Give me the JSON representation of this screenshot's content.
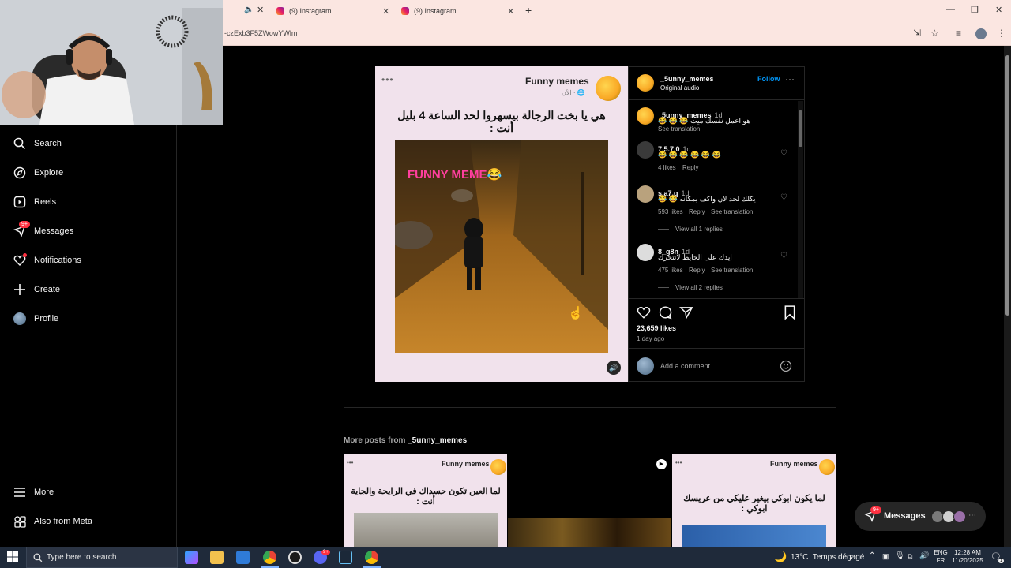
{
  "browser": {
    "tabs": [
      {
        "label": "(9) Instagram"
      },
      {
        "label": "(9) Instagram"
      }
    ],
    "url": "-czExb3F5ZWowYWlm"
  },
  "sidebar": {
    "items": [
      {
        "label": "Search",
        "icon": "search-icon"
      },
      {
        "label": "Explore",
        "icon": "compass-icon"
      },
      {
        "label": "Reels",
        "icon": "reels-icon"
      },
      {
        "label": "Messages",
        "icon": "messenger-icon",
        "badge": "9+"
      },
      {
        "label": "Notifications",
        "icon": "heart-icon"
      },
      {
        "label": "Create",
        "icon": "plus-icon"
      },
      {
        "label": "Profile",
        "icon": "avatar"
      }
    ],
    "more": "More",
    "also_from_meta": "Also from Meta"
  },
  "post": {
    "media": {
      "page_name": "Funny memes",
      "time_line": "الآن · 🌐",
      "caption": "هي يا بخت الرجالة بيسهروا لحد الساعة 4 بليل أنت :",
      "overlay_logo": "FUNNY MEME😂"
    },
    "author": "_5unny_memes",
    "follow_label": "Follow",
    "audio": "Original audio",
    "comments": [
      {
        "user": "_5unny_memes",
        "time": "1d",
        "text": "هو اعمل نفسك ميت 😂 😂 😂",
        "translation": "See translation"
      },
      {
        "user": "7.5.7.0",
        "time": "1d",
        "text": "😂 😂 😂 😂 😂 😂",
        "likes": "4 likes",
        "reply": "Reply"
      },
      {
        "user": "s.a7.q",
        "time": "1d",
        "text": "يكلك لحد لان واكف بمكانه 😂 😂",
        "likes": "593 likes",
        "reply": "Reply",
        "translation": "See translation",
        "view_replies": "View all 1 replies"
      },
      {
        "user": "8_g8n",
        "time": "1d",
        "text": "ايدك على الحايط لاتتحرك",
        "likes": "475 likes",
        "reply": "Reply",
        "translation": "See translation",
        "view_replies": "View all 2 replies"
      }
    ],
    "likes": "23,659 likes",
    "posted": "1 day ago",
    "comment_placeholder": "Add a comment..."
  },
  "more_posts": {
    "heading_prefix": "More posts from ",
    "heading_user": "_5unny_memes",
    "thumbs": [
      {
        "page_name": "Funny memes",
        "caption": "لما العين تكون حسداك في الرايحة والجاية أنت :"
      },
      {
        "page_name": "",
        "caption": ""
      },
      {
        "page_name": "Funny memes",
        "caption": "لما يكون ابوكي بيغير عليكي من عريسك ابوكي :"
      }
    ]
  },
  "messages_pill": {
    "label": "Messages",
    "badge": "9+"
  },
  "taskbar": {
    "search_placeholder": "Type here to search",
    "weather": "13°C  Temps dégagé",
    "lang_top": "ENG",
    "lang_bottom": "FR",
    "time": "12:28 AM",
    "date": "11/20/2025",
    "notif_count": "1"
  },
  "colors": {
    "instagram_blue": "#0095f6",
    "meme_bg": "#f1e2ec",
    "badge_red": "#ff3040"
  }
}
